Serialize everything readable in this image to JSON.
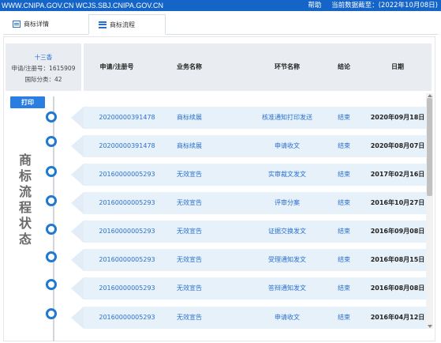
{
  "topbar": {
    "site": "WWW.CNIPA.GOV.CN WCJS.SBJ.CNIPA.GOV.CN",
    "help": "帮助",
    "data_as_of": "当前数据截至：(2022年10月08日)"
  },
  "tabs": [
    {
      "label": "商标详情"
    },
    {
      "label": "商标流程"
    }
  ],
  "summary": {
    "name": "十三香",
    "reg_no": "申请/注册号：1615909",
    "intl_class": "国际分类：42"
  },
  "table": {
    "headers": [
      "申请/注册号",
      "业务名称",
      "环节名称",
      "结论",
      "日期"
    ]
  },
  "print_label": "打印",
  "vertical_title": [
    "商",
    "标",
    "流",
    "程",
    "状",
    "态"
  ],
  "rows": [
    {
      "number": "20200000391478",
      "business": "商标续展",
      "step": "核准通知打印发送",
      "result": "结束",
      "date": "2020年09月18日"
    },
    {
      "number": "20200000391478",
      "business": "商标续展",
      "step": "申请收文",
      "result": "结束",
      "date": "2020年08月07日"
    },
    {
      "number": "20160000005293",
      "business": "无效宣告",
      "step": "实审裁文发文",
      "result": "结束",
      "date": "2017年02月16日"
    },
    {
      "number": "20160000005293",
      "business": "无效宣告",
      "step": "评审分案",
      "result": "结束",
      "date": "2016年10月27日"
    },
    {
      "number": "20160000005293",
      "business": "无效宣告",
      "step": "证据交换发文",
      "result": "结束",
      "date": "2016年09月08日"
    },
    {
      "number": "20160000005293",
      "business": "无效宣告",
      "step": "受理通知发文",
      "result": "结束",
      "date": "2016年08月15日"
    },
    {
      "number": "20160000005293",
      "business": "无效宣告",
      "step": "答辩通知发文",
      "result": "结束",
      "date": "2016年08月08日"
    },
    {
      "number": "20160000005293",
      "business": "无效宣告",
      "step": "申请收文",
      "result": "结束",
      "date": "2016年04月12日"
    }
  ]
}
